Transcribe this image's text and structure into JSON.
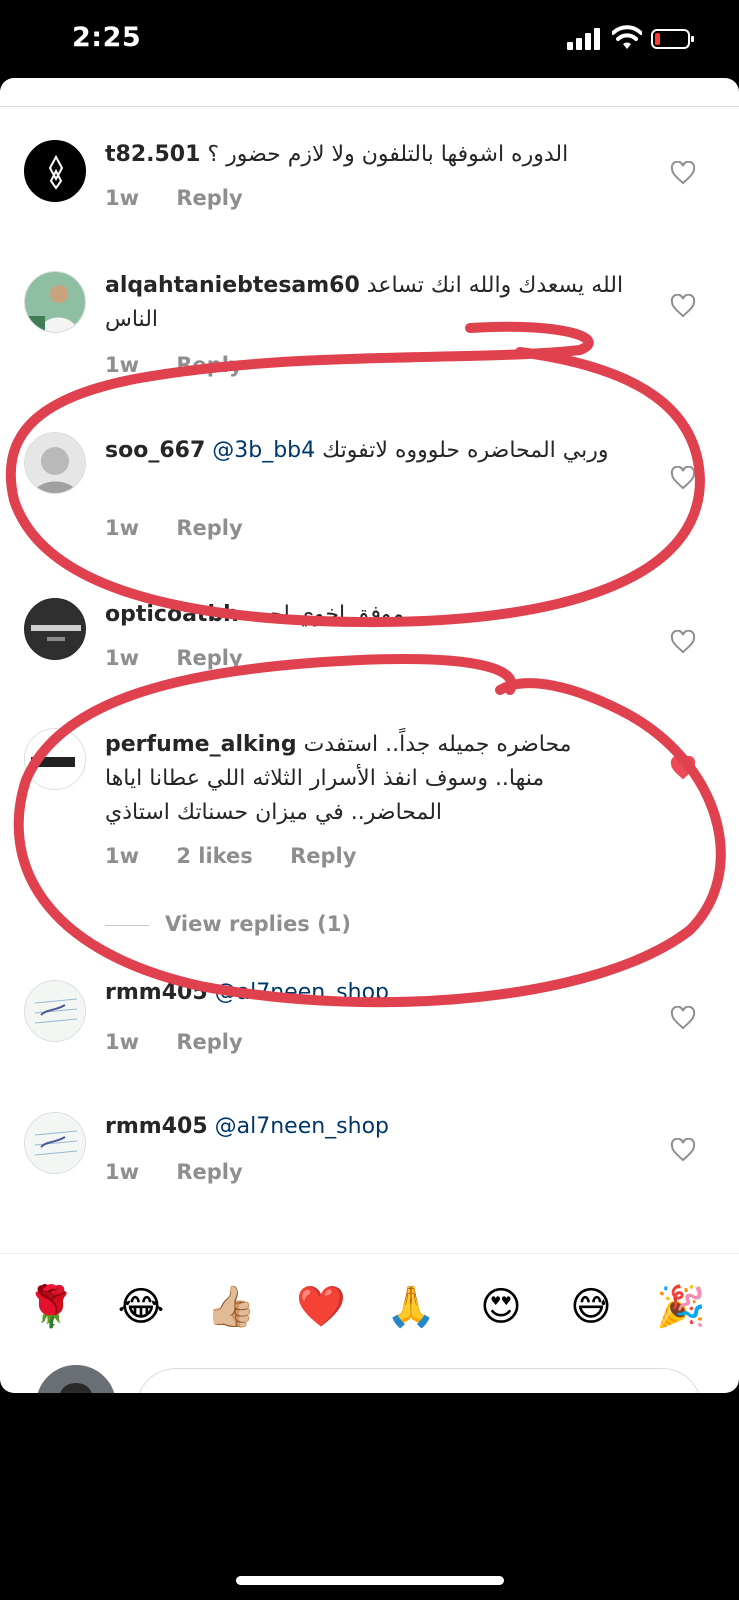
{
  "status": {
    "time": "2:25"
  },
  "comments": [
    {
      "username": "t82.501",
      "text": "الدوره اشوفها بالتلفون ولا لازم حضور ؟",
      "time": "1w",
      "reply": "Reply",
      "liked": false
    },
    {
      "username": "alqahtaniebtesam60",
      "text": "الله يسعدك والله انك تساعد الناس",
      "time": "1w",
      "reply": "Reply",
      "liked": false
    },
    {
      "username": "soo_667",
      "mention": "@3b_bb4",
      "text": "وربي المحاضره حلوووه لاتفوتك",
      "time": "1w",
      "reply": "Reply",
      "liked": false
    },
    {
      "username": "opticoatbh",
      "text": "موفق اخوي احمد",
      "time": "1w",
      "reply": "Reply",
      "liked": false
    },
    {
      "username": "perfume_alking",
      "text": "محاضره جميله جداً.. استفدت منها.. وسوف انفذ الأسرار الثلاثه اللي عطانا اياها المحاضر.. في ميزان حسناتك استاذي",
      "time": "1w",
      "likes": "2 likes",
      "reply": "Reply",
      "view_replies": "View replies (1)",
      "liked": true
    },
    {
      "username": "rmm405",
      "mention": "@al7neen_shop",
      "time": "1w",
      "reply": "Reply",
      "liked": false
    },
    {
      "username": "rmm405",
      "mention": "@al7neen_shop",
      "time": "1w",
      "reply": "Reply",
      "liked": false
    }
  ],
  "emoji_bar": [
    "🌹",
    "😂",
    "👍🏼",
    "❤️",
    "🙏",
    "😍",
    "😅",
    "🎉"
  ],
  "colors": {
    "annotation": "#e0414f",
    "like_red": "#ed4956",
    "meta_gray": "#8e8e8e",
    "mention_blue": "#00376b"
  }
}
